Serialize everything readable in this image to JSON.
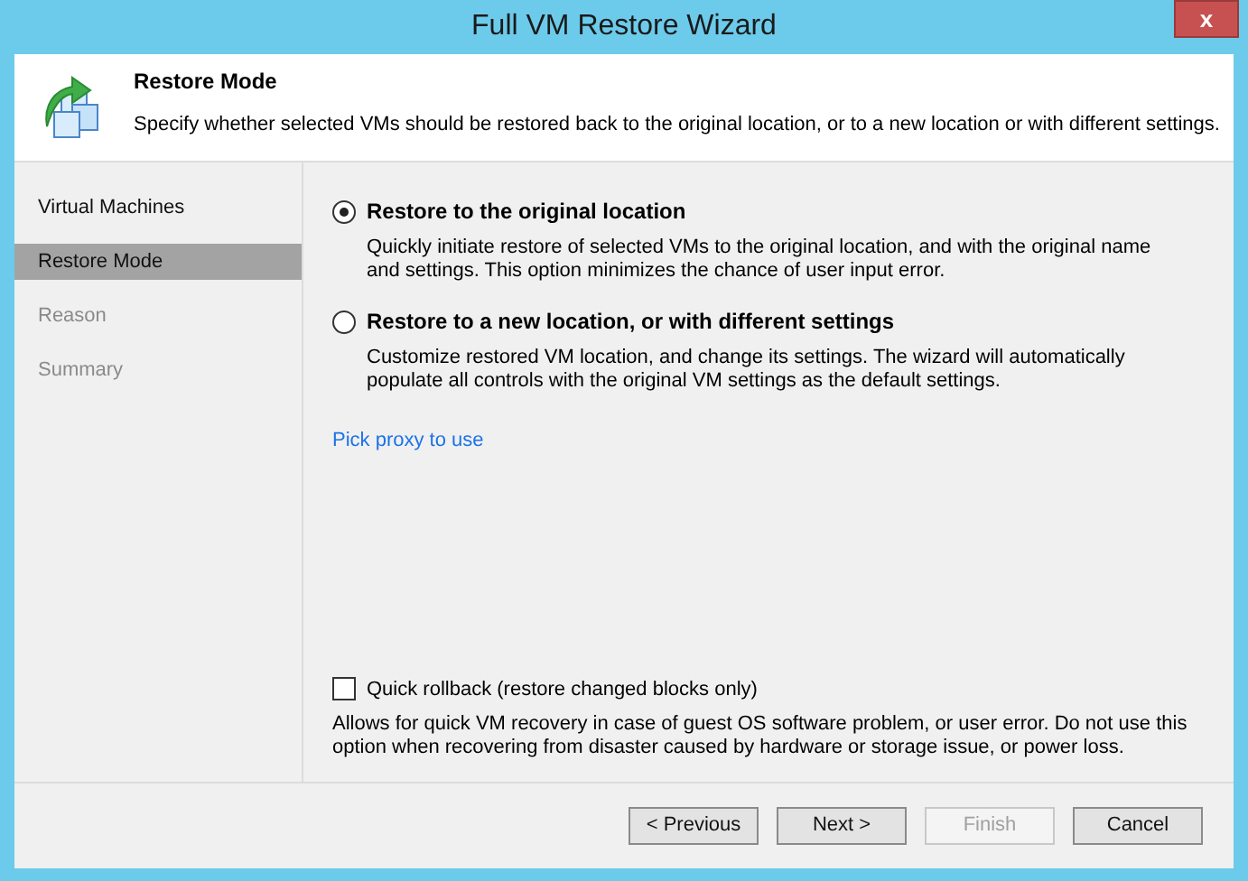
{
  "window": {
    "title": "Full VM Restore Wizard",
    "close": "x"
  },
  "header": {
    "title": "Restore Mode",
    "description": "Specify whether selected VMs should be restored back to the original location, or to a new location or with different settings."
  },
  "steps": [
    {
      "label": "Virtual Machines",
      "selected": false,
      "disabled": false
    },
    {
      "label": "Restore Mode",
      "selected": true,
      "disabled": false
    },
    {
      "label": "Reason",
      "selected": false,
      "disabled": true
    },
    {
      "label": "Summary",
      "selected": false,
      "disabled": true
    }
  ],
  "options": [
    {
      "label": "Restore to the original location",
      "description": "Quickly initiate restore of selected VMs to the original location, and with the original name and settings. This option minimizes the chance of user input error.",
      "selected": true
    },
    {
      "label": "Restore to a new location, or with different settings",
      "description": "Customize restored VM location, and change its settings. The wizard will automatically populate all controls with the original VM settings as the default settings.",
      "selected": false
    }
  ],
  "link": "Pick proxy to use",
  "quick_rollback": {
    "label": "Quick rollback (restore changed blocks only)",
    "checked": false,
    "description": "Allows for quick VM recovery in case of guest OS software problem, or user error. Do not use this option when recovering from disaster caused by hardware or storage issue, or power loss."
  },
  "buttons": [
    {
      "label": "< Previous",
      "disabled": false
    },
    {
      "label": "Next >",
      "disabled": false
    },
    {
      "label": "Finish",
      "disabled": true
    },
    {
      "label": "Cancel",
      "disabled": false
    }
  ]
}
